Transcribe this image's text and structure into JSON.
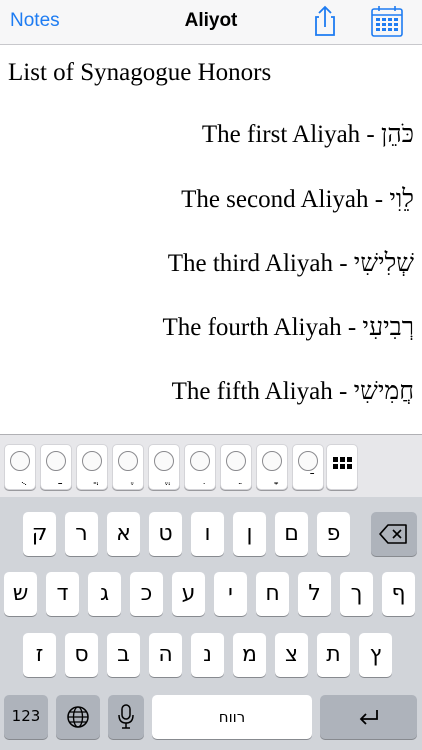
{
  "navbar": {
    "back_label": "Notes",
    "title": "Aliyot",
    "icons": [
      "share-icon",
      "calendar-icon"
    ]
  },
  "content": {
    "title": "List of Synagogue Honors",
    "aliyot": [
      "The first Aliyah - כֹּהֵן",
      "The second Aliyah - לֵוִי",
      "The third Aliyah - שְׁלִישִׁי",
      "The fourth Aliyah - רְבִיעִי",
      "The fifth Aliyah - חֲמִישִׁי"
    ]
  },
  "vowel_bar": {
    "marks": [
      "ֻ",
      "ַ",
      "ֲ",
      "ֶ",
      "ֱ",
      "ִ",
      "ֵ",
      "ָ",
      "ֿ"
    ]
  },
  "keyboard": {
    "row1": [
      "ק",
      "ר",
      "א",
      "ט",
      "ו",
      "ן",
      "ם",
      "פ"
    ],
    "row2": [
      "ש",
      "ד",
      "ג",
      "כ",
      "ע",
      "י",
      "ח",
      "ל",
      "ך",
      "ף"
    ],
    "row3": [
      "ז",
      "ס",
      "ב",
      "ה",
      "נ",
      "מ",
      "צ",
      "ת",
      "ץ"
    ],
    "numbers_label": "123",
    "space_label": "רווח"
  },
  "colors": {
    "accent": "#1e7cf2",
    "keyboard_bg": "#d1d4d9",
    "function_key": "#aeb3bb"
  }
}
